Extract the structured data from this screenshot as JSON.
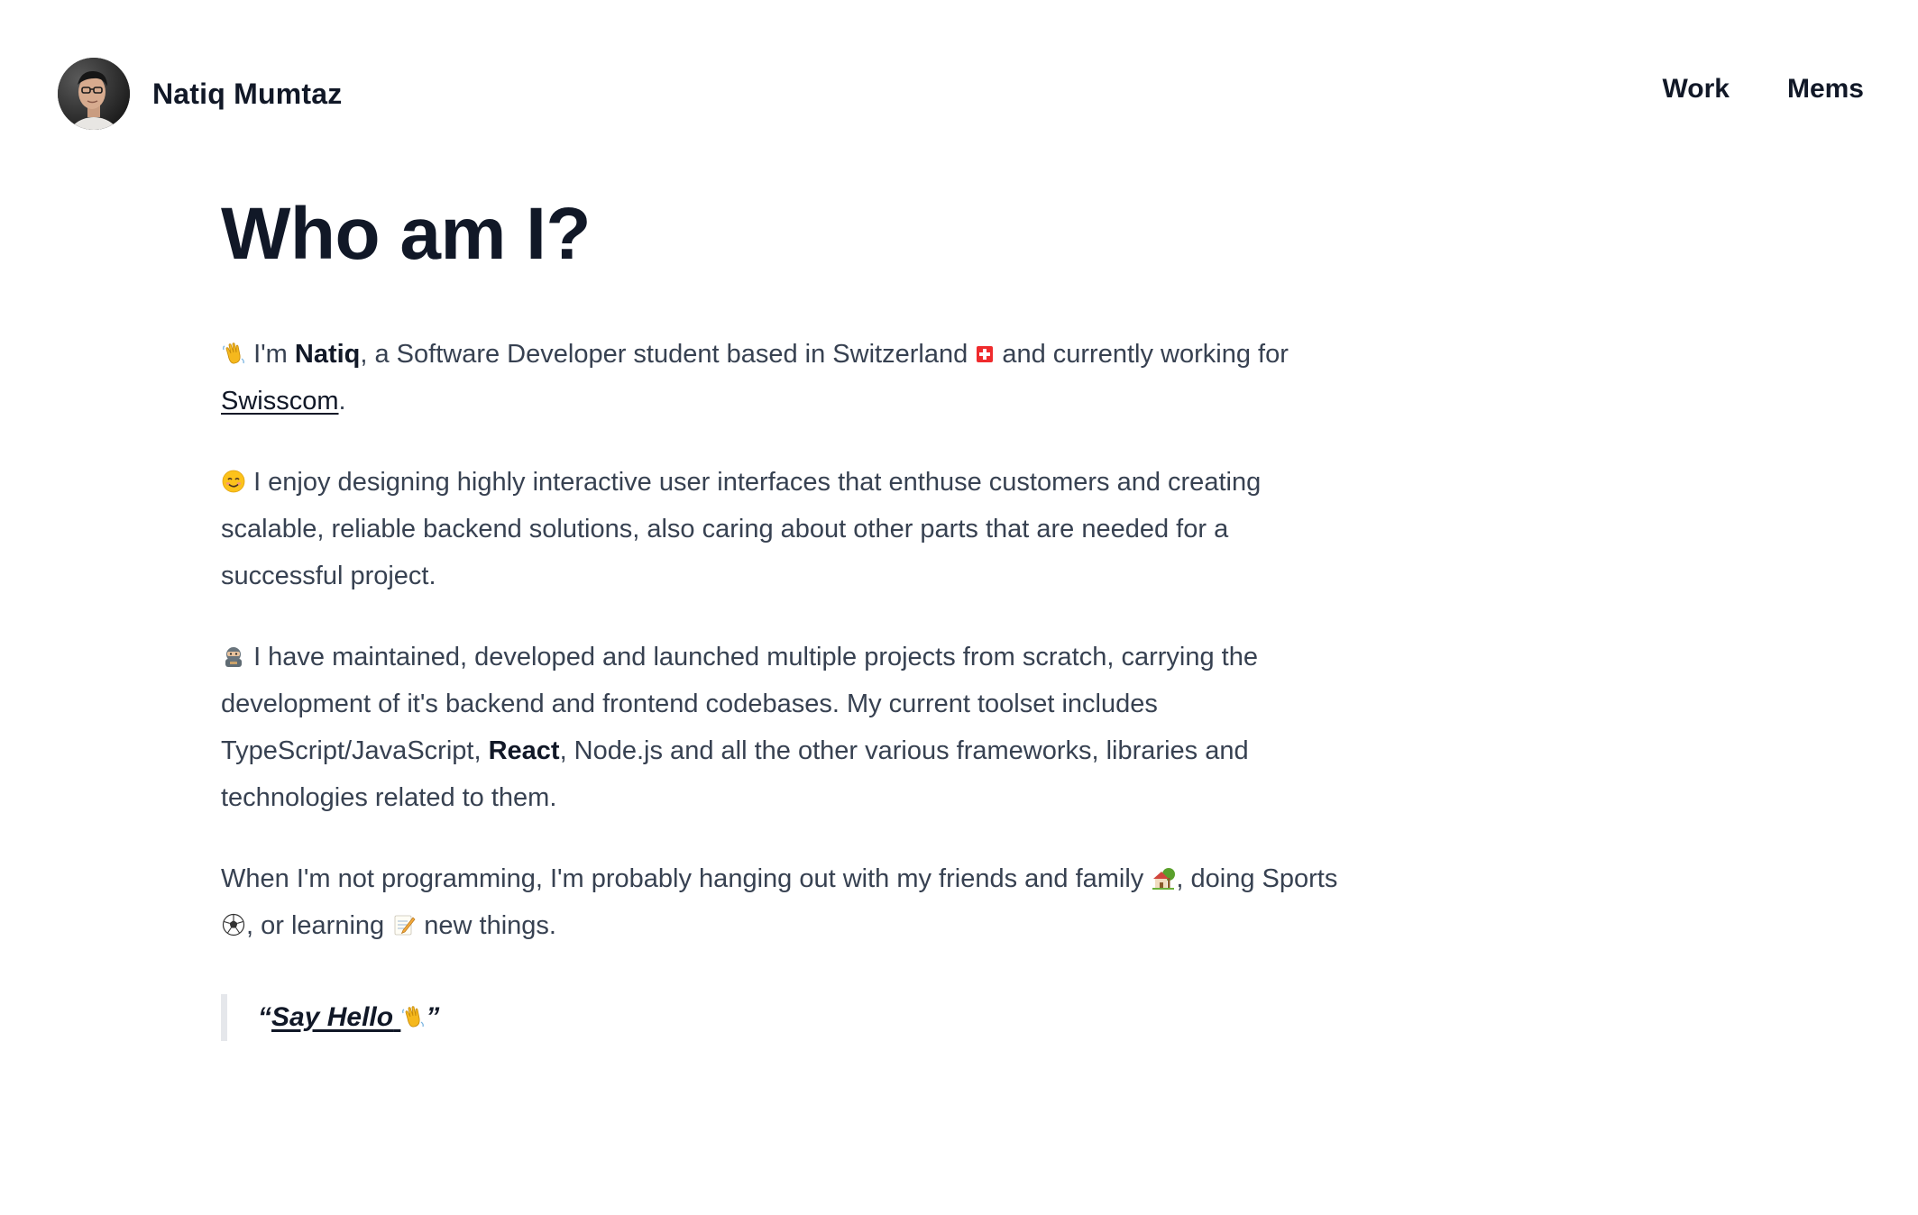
{
  "header": {
    "name": "Natiq Mumtaz",
    "nav": {
      "work": "Work",
      "mems": "Mems"
    }
  },
  "main": {
    "title": "Who am I?",
    "p1": {
      "intro": "I'm ",
      "name": "Natiq",
      "text1": ", a Software Developer student based in Switzerland ",
      "text2": " and currently working for ",
      "link": "Swisscom",
      "end": "."
    },
    "p2": {
      "text": "I enjoy designing highly interactive user interfaces that enthuse customers and creating scalable, reliable backend solutions, also caring about other parts that are needed for a successful project."
    },
    "p3": {
      "text1": "I have maintained, developed and launched multiple projects from scratch, carrying the development of it's backend and frontend codebases. My current toolset includes TypeScript/JavaScript, ",
      "bold": "React",
      "text2": ", Node.js and all the other various frameworks, libraries and technologies related to them."
    },
    "p4": {
      "text1": "When I'm not programming, I'm probably hanging out with my friends and family ",
      "text2": ", doing Sports ",
      "text3": ", or learning ",
      "text4": " new things."
    },
    "quote": {
      "open": "“",
      "link": "Say Hello",
      "close": "”"
    }
  },
  "icons": {
    "avatar": "profile-photo",
    "wave": "waving-hand-icon",
    "flag": "swiss-flag-icon",
    "smile": "smiling-face-icon",
    "ninja": "ninja-icon",
    "house": "house-with-garden-icon",
    "soccer": "soccer-ball-icon",
    "memo": "memo-icon"
  },
  "colors": {
    "heading": "#111827",
    "body": "#374151",
    "quote_border": "#e5e7eb",
    "swiss_red": "#ef2b2d"
  }
}
